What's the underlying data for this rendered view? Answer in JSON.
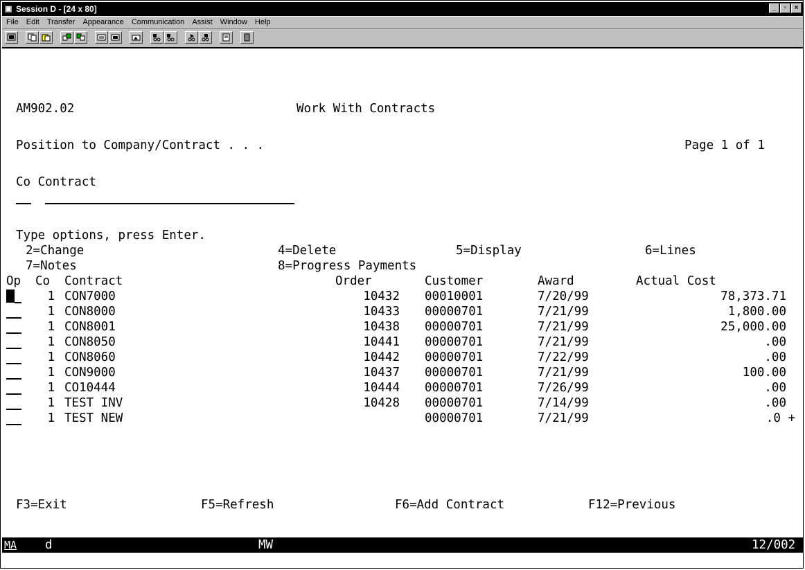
{
  "window": {
    "title": "Session D - [24 x 80]",
    "controls": [
      "_",
      "▫",
      "×"
    ]
  },
  "menu": [
    {
      "label": "File"
    },
    {
      "label": "Edit"
    },
    {
      "label": "Transfer"
    },
    {
      "label": "Appearance"
    },
    {
      "label": "Communication"
    },
    {
      "label": "Assist"
    },
    {
      "label": "Window"
    },
    {
      "label": "Help"
    }
  ],
  "toolbar_icons": [
    "print-screen-icon",
    "copy-icon",
    "paste-icon",
    "send-icon",
    "receive-icon",
    "keypad-icon",
    "display-icon",
    "macro-icon",
    "record-icon",
    "stop-record-icon",
    "play-icon",
    "play-stop-icon",
    "clipboard-icon",
    "exit-icon"
  ],
  "screen": {
    "program_id": "AM902.02",
    "title": "Work With Contracts",
    "position_label": "Position to Company/Contract . . .",
    "page": "Page 1 of 1",
    "co_contract_label": "Co Contract",
    "instructions": "Type options, press Enter.",
    "options": [
      {
        "text": "2=Change"
      },
      {
        "text": "4=Delete"
      },
      {
        "text": "5=Display"
      },
      {
        "text": "6=Lines"
      },
      {
        "text": "7=Notes"
      },
      {
        "text": "8=Progress Payments"
      }
    ],
    "columns": {
      "op": "Op",
      "co": "Co",
      "contract": "Contract",
      "order": "Order",
      "customer": "Customer",
      "award": "Award",
      "actual_cost": "Actual Cost"
    },
    "rows": [
      {
        "co": "1",
        "contract": "CON7000",
        "order": "10432",
        "customer": "00010001",
        "award": "7/20/99",
        "actual_cost": "78,373.71"
      },
      {
        "co": "1",
        "contract": "CON8000",
        "order": "10433",
        "customer": "00000701",
        "award": "7/21/99",
        "actual_cost": "1,800.00"
      },
      {
        "co": "1",
        "contract": "CON8001",
        "order": "10438",
        "customer": "00000701",
        "award": "7/21/99",
        "actual_cost": "25,000.00"
      },
      {
        "co": "1",
        "contract": "CON8050",
        "order": "10441",
        "customer": "00000701",
        "award": "7/21/99",
        "actual_cost": ".00"
      },
      {
        "co": "1",
        "contract": "CON8060",
        "order": "10442",
        "customer": "00000701",
        "award": "7/22/99",
        "actual_cost": ".00"
      },
      {
        "co": "1",
        "contract": "CON9000",
        "order": "10437",
        "customer": "00000701",
        "award": "7/21/99",
        "actual_cost": "100.00"
      },
      {
        "co": "1",
        "contract": "CO10444",
        "order": "10444",
        "customer": "00000701",
        "award": "7/26/99",
        "actual_cost": ".00"
      },
      {
        "co": "1",
        "contract": "TEST INV",
        "order": "10428",
        "customer": "00000701",
        "award": "7/14/99",
        "actual_cost": ".00"
      },
      {
        "co": "1",
        "contract": "TEST NEW",
        "order": "",
        "customer": "00000701",
        "award": "7/21/99",
        "actual_cost": ".0 +"
      }
    ],
    "fkeys": [
      {
        "text": "F3=Exit"
      },
      {
        "text": "F5=Refresh"
      },
      {
        "text": "F6=Add Contract"
      },
      {
        "text": "F12=Previous"
      }
    ]
  },
  "status": {
    "session": "MA",
    "indicator": "d",
    "mode": "MW",
    "cursor_pos": "12/002"
  }
}
